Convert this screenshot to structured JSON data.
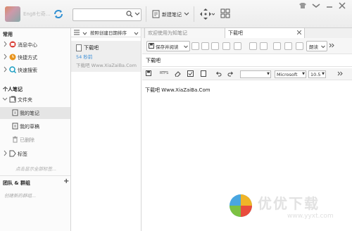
{
  "topbar": {
    "username": "Eng8七奇…",
    "search_placeholder": "",
    "new_note_label": "新建笔记"
  },
  "sidebar": {
    "common_header": "常用",
    "common_items": [
      {
        "label": "消息中心",
        "icon": "message-center-icon"
      },
      {
        "label": "快捷方式",
        "icon": "shortcuts-icon"
      },
      {
        "label": "快速搜索",
        "icon": "quick-search-icon"
      }
    ],
    "personal_header": "个人笔记",
    "folder_label": "文件夹",
    "folder_items": [
      {
        "label": "我的笔记"
      },
      {
        "label": "我的草稿"
      },
      {
        "label": "已删除"
      }
    ],
    "tags_label": "标签",
    "tags_hint": "点击显示全部标签...",
    "team_header": "团队 & 群组",
    "team_add": "+",
    "team_hint": "创建新的群组..."
  },
  "notelist": {
    "sort_label": "按照创建日期排序",
    "note": {
      "title": "下载吧",
      "time": "54 秒前",
      "preview": "下载吧 Www.XiaZaiBa.Com"
    }
  },
  "editor": {
    "tabs": [
      {
        "label": "欢迎使用为知笔记"
      },
      {
        "label": "下载吧"
      }
    ],
    "save_read_label": "保存并阅读",
    "read_aloud_label": "朗读",
    "note_title": "下载吧",
    "font_name": "Microsoft",
    "font_size": "10.5",
    "body": "下载吧 Www.XiaZaiBa.Com"
  },
  "watermark": {
    "cn": "优优下载",
    "url": "www.yyxt.com"
  },
  "colors": {
    "accent_blue": "#3d8fd6",
    "selected_bg": "#e5e5e5",
    "red": "#d9423a",
    "orange": "#e8941d",
    "teal": "#1b9ec2"
  }
}
